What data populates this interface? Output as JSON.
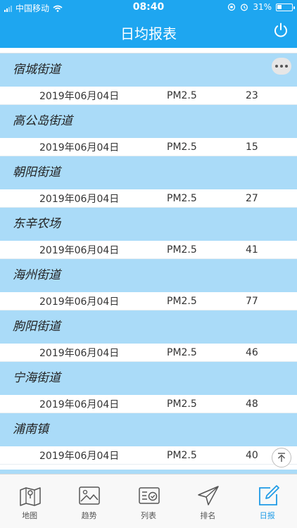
{
  "status_bar": {
    "carrier": "中国移动",
    "time": "08:40",
    "battery": "31%",
    "battery_level": 0.31
  },
  "header": {
    "title": "日均报表",
    "power_icon": "power-icon"
  },
  "sections": [
    {
      "name": "宿城街道",
      "date": "2019年06月04日",
      "pollutant": "PM2.5",
      "value": "23"
    },
    {
      "name": "高公岛街道",
      "date": "2019年06月04日",
      "pollutant": "PM2.5",
      "value": "15"
    },
    {
      "name": "朝阳街道",
      "date": "2019年06月04日",
      "pollutant": "PM2.5",
      "value": "27"
    },
    {
      "name": "东辛农场",
      "date": "2019年06月04日",
      "pollutant": "PM2.5",
      "value": "41"
    },
    {
      "name": "海州街道",
      "date": "2019年06月04日",
      "pollutant": "PM2.5",
      "value": "77"
    },
    {
      "name": "朐阳街道",
      "date": "2019年06月04日",
      "pollutant": "PM2.5",
      "value": "46"
    },
    {
      "name": "宁海街道",
      "date": "2019年06月04日",
      "pollutant": "PM2.5",
      "value": "48"
    },
    {
      "name": "浦南镇",
      "date": "2019年06月04日",
      "pollutant": "PM2.5",
      "value": "40"
    }
  ],
  "floating": {
    "more_icon": "more-icon",
    "top_icon": "back-to-top-icon"
  },
  "tabbar": {
    "tabs": [
      {
        "label": "地图",
        "icon": "map-icon"
      },
      {
        "label": "趋势",
        "icon": "image-icon"
      },
      {
        "label": "列表",
        "icon": "list-check-icon"
      },
      {
        "label": "排名",
        "icon": "send-icon"
      },
      {
        "label": "日报",
        "icon": "edit-icon",
        "active": true
      }
    ]
  },
  "colors": {
    "header": "#1ea6f0",
    "section_head": "#aadbf8",
    "active_tab": "#1e9be6"
  }
}
